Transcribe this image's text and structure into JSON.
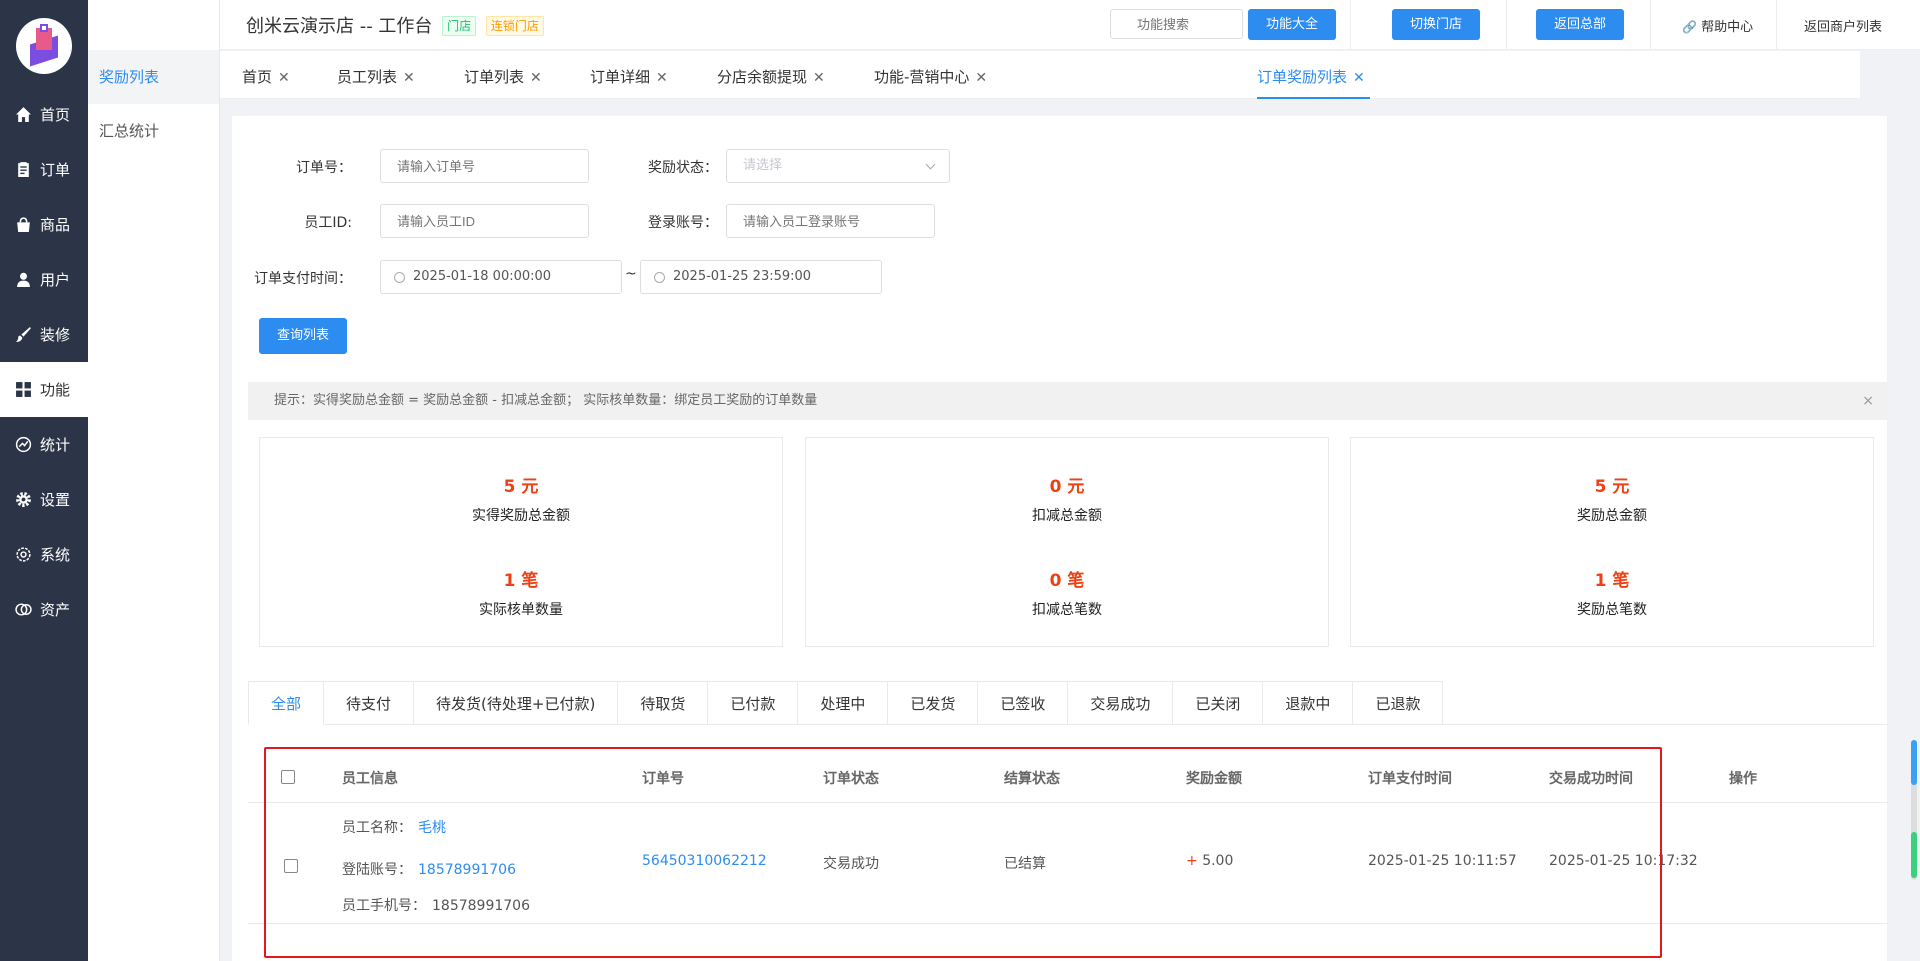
{
  "sidebar": {
    "items": [
      {
        "label": "首页",
        "icon": "home-icon"
      },
      {
        "label": "订单",
        "icon": "clipboard-icon"
      },
      {
        "label": "商品",
        "icon": "bag-icon"
      },
      {
        "label": "用户",
        "icon": "user-icon"
      },
      {
        "label": "装修",
        "icon": "brush-icon"
      },
      {
        "label": "功能",
        "icon": "grid-icon"
      },
      {
        "label": "统计",
        "icon": "chart-icon"
      },
      {
        "label": "设置",
        "icon": "gear-icon"
      },
      {
        "label": "系统",
        "icon": "cog-icon"
      },
      {
        "label": "资产",
        "icon": "coins-icon"
      }
    ],
    "active": "功能"
  },
  "subnav": {
    "items": [
      "奖励列表",
      "汇总统计"
    ]
  },
  "header": {
    "title": "创米云演示店 -- 工作台",
    "tag_store": "门店",
    "tag_chain": "连锁门店",
    "search_placeholder": "功能搜索",
    "btn_functions": "功能大全",
    "btn_switch": "切换门店",
    "btn_hq": "返回总部",
    "help": "帮助中心",
    "back_list": "返回商户列表"
  },
  "page_tabs": [
    "首页",
    "员工列表",
    "订单列表",
    "订单详细",
    "分店余额提现",
    "功能-营销中心",
    "订单奖励列表"
  ],
  "filters": {
    "order_no_label": "订单号：",
    "order_no_placeholder": "请输入订单号",
    "reward_status_label": "奖励状态：",
    "reward_status_placeholder": "请选择",
    "staff_id_label": "员工ID:",
    "staff_id_placeholder": "请输入员工ID",
    "login_label": "登录账号：",
    "login_placeholder": "请输入员工登录账号",
    "pay_time_label": "订单支付时间：",
    "date_from": "2025-01-18 00:00:00",
    "date_to": "2025-01-25 23:59:00",
    "range_sep": "~",
    "query_button": "查询列表"
  },
  "tip": {
    "text": "提示：实得奖励总金额 = 奖励总金额 - 扣减总金额；  实际核单数量：绑定员工奖励的订单数量",
    "close": "×"
  },
  "stats": [
    {
      "v1": "5 元",
      "l1": "实得奖励总金额",
      "v2": "1 笔",
      "l2": "实际核单数量"
    },
    {
      "v1": "0 元",
      "l1": "扣减总金额",
      "v2": "0 笔",
      "l2": "扣减总笔数"
    },
    {
      "v1": "5 元",
      "l1": "奖励总金额",
      "v2": "1 笔",
      "l2": "奖励总笔数"
    }
  ],
  "status_tabs": [
    "全部",
    "待支付",
    "待发货(待处理+已付款)",
    "待取货",
    "已付款",
    "处理中",
    "已发货",
    "已签收",
    "交易成功",
    "已关闭",
    "退款中",
    "已退款"
  ],
  "table": {
    "headers": [
      "员工信息",
      "订单号",
      "订单状态",
      "结算状态",
      "奖励金额",
      "订单支付时间",
      "交易成功时间",
      "操作"
    ],
    "row": {
      "name_label": "员工名称：",
      "name": "毛桃",
      "login_label": "登陆账号：",
      "login": "18578991706",
      "phone_label": "员工手机号：",
      "phone": "18578991706",
      "order_no": "56450310062212",
      "order_status": "交易成功",
      "settle_status": "已结算",
      "amount_sign": "+",
      "amount": "5.00",
      "pay_time": "2025-01-25 10:11:57",
      "success_time": "2025-01-25 10:17:32"
    }
  }
}
